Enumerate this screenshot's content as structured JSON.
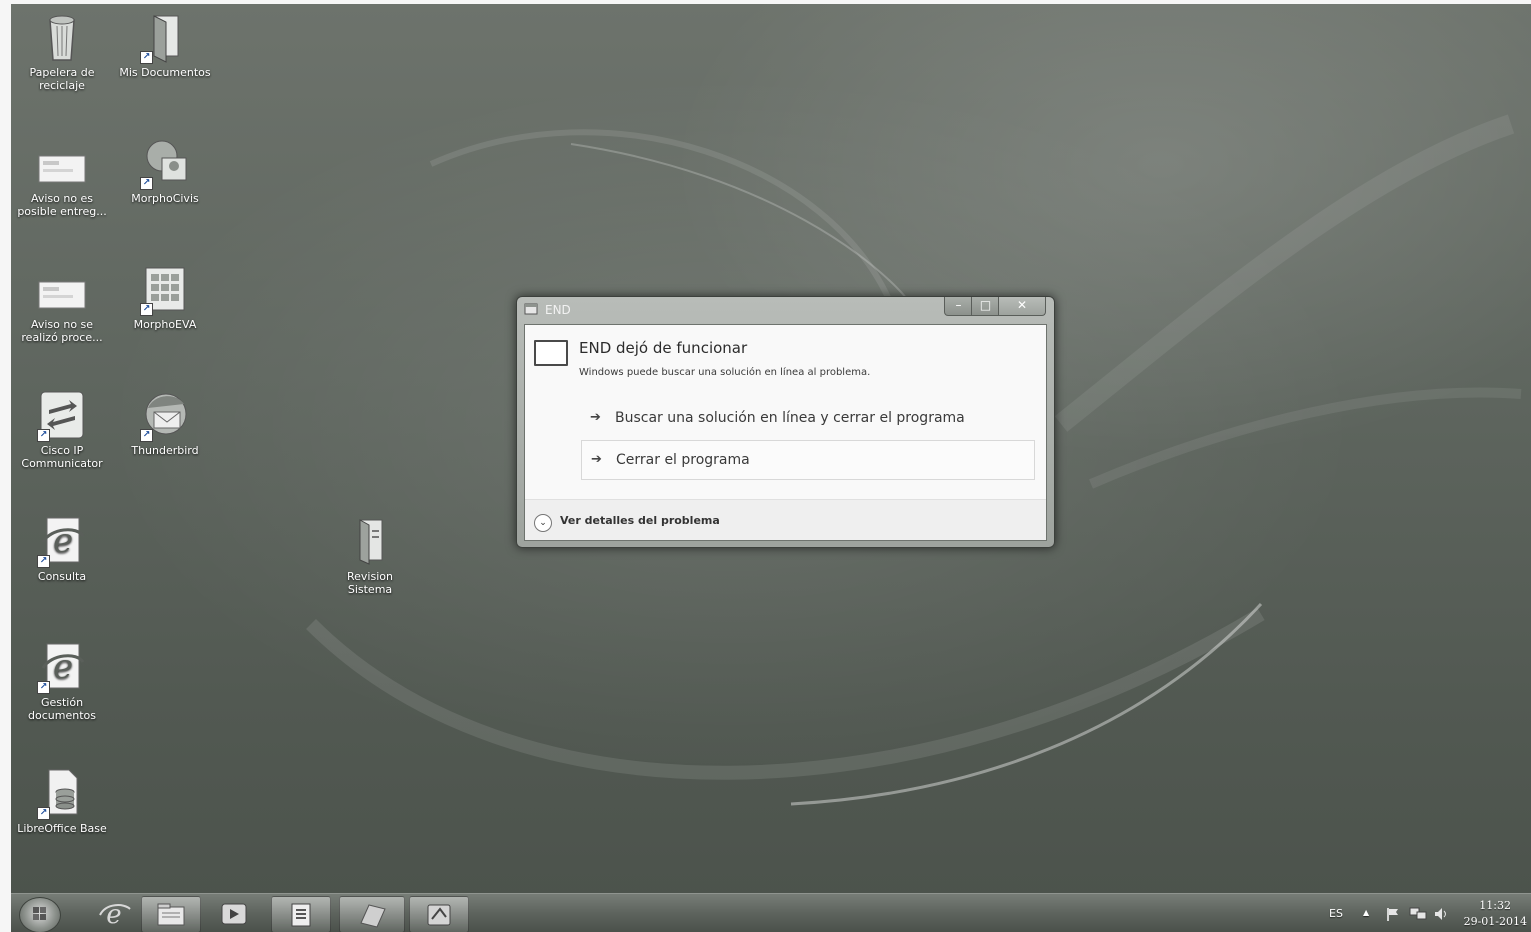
{
  "desktop": {
    "icons": [
      {
        "label": "Papelera de reciclaje",
        "icon": "recycle-bin-icon"
      },
      {
        "label": "Mis Documentos",
        "icon": "documents-folder-icon"
      },
      {
        "label": "Aviso no es posible entreg...",
        "icon": "document-thumbnail-icon"
      },
      {
        "label": "MorphoCivis",
        "icon": "morphocivis-icon"
      },
      {
        "label": "Aviso no se realizó proce...",
        "icon": "document-thumbnail-icon"
      },
      {
        "label": "MorphoEVA",
        "icon": "morphoeva-icon"
      },
      {
        "label": "Cisco IP Communicator",
        "icon": "cisco-icon"
      },
      {
        "label": "Thunderbird",
        "icon": "thunderbird-icon"
      },
      {
        "label": "Consulta",
        "icon": "internet-explorer-icon"
      },
      {
        "label": "Revision Sistema",
        "icon": "document-icon"
      },
      {
        "label": "Gestión documentos",
        "icon": "internet-explorer-icon"
      },
      {
        "label": "LibreOffice Base",
        "icon": "libreoffice-base-icon"
      }
    ]
  },
  "dialog": {
    "title": "END",
    "heading": "END dejó de funcionar",
    "subtext": "Windows puede buscar una solución en línea al problema.",
    "options": [
      {
        "label": "Buscar una solución en línea y cerrar el programa"
      },
      {
        "label": "Cerrar el programa"
      }
    ],
    "details": "Ver detalles del problema",
    "buttons": {
      "minimize": "–",
      "maximize": "□",
      "close": "✕"
    }
  },
  "taskbar": {
    "pinned": [
      "internet-explorer-icon",
      "folder-icon",
      "media-player-icon",
      "document-icon",
      "app-icon",
      "app-icon"
    ],
    "tray": {
      "language": "ES",
      "show_hidden": "▲",
      "time": "11:32",
      "date": "29-01-2014"
    }
  }
}
